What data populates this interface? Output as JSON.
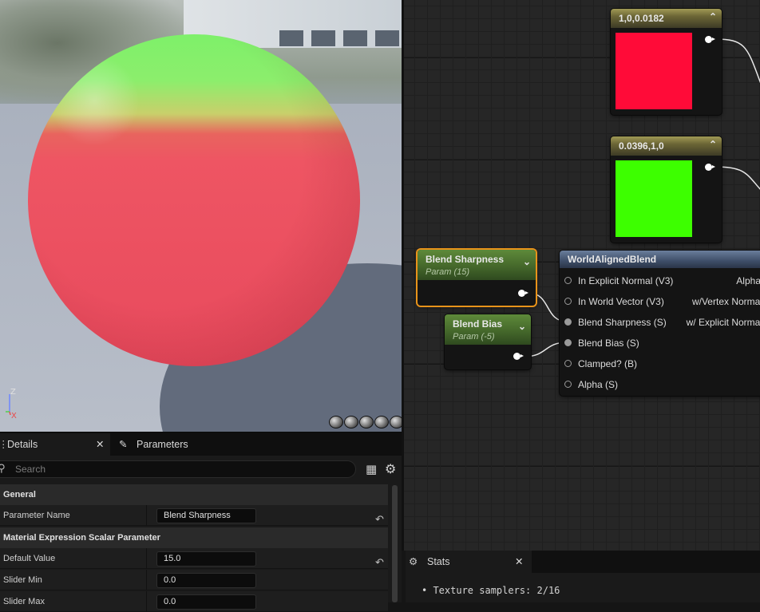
{
  "viewport": {
    "axis": {
      "z_label": "Z",
      "x_label": "X"
    }
  },
  "graph": {
    "constant_red": {
      "title": "1,0,0.0182",
      "color": "#ff0b38"
    },
    "constant_green": {
      "title": "0.0396,1,0",
      "color": "#3dff00"
    },
    "blend_sharpness": {
      "title": "Blend Sharpness",
      "subtitle": "Param (15)"
    },
    "blend_bias": {
      "title": "Blend Bias",
      "subtitle": "Param (-5)"
    },
    "world_aligned_blend": {
      "title": "WorldAlignedBlend",
      "inputs": [
        "In Explicit Normal (V3)",
        "In World Vector (V3)",
        "Blend Sharpness (S)",
        "Blend Bias (S)",
        "Clamped? (B)",
        "Alpha (S)"
      ],
      "outputs": [
        "Alpha",
        "w/Vertex Normals",
        "w/ Explicit Normal"
      ]
    }
  },
  "details": {
    "tabs": {
      "details": "Details",
      "parameters": "Parameters"
    },
    "search_placeholder": "Search",
    "sections": {
      "general": "General",
      "scalar": "Material Expression Scalar Parameter"
    },
    "props": {
      "parameter_name": {
        "label": "Parameter Name",
        "value": "Blend Sharpness"
      },
      "default_value": {
        "label": "Default Value",
        "value": "15.0"
      },
      "slider_min": {
        "label": "Slider Min",
        "value": "0.0"
      },
      "slider_max": {
        "label": "Slider Max",
        "value": "0.0"
      }
    }
  },
  "stats": {
    "tab": "Stats",
    "lines": [
      "• Texture samplers: 2/16"
    ]
  }
}
